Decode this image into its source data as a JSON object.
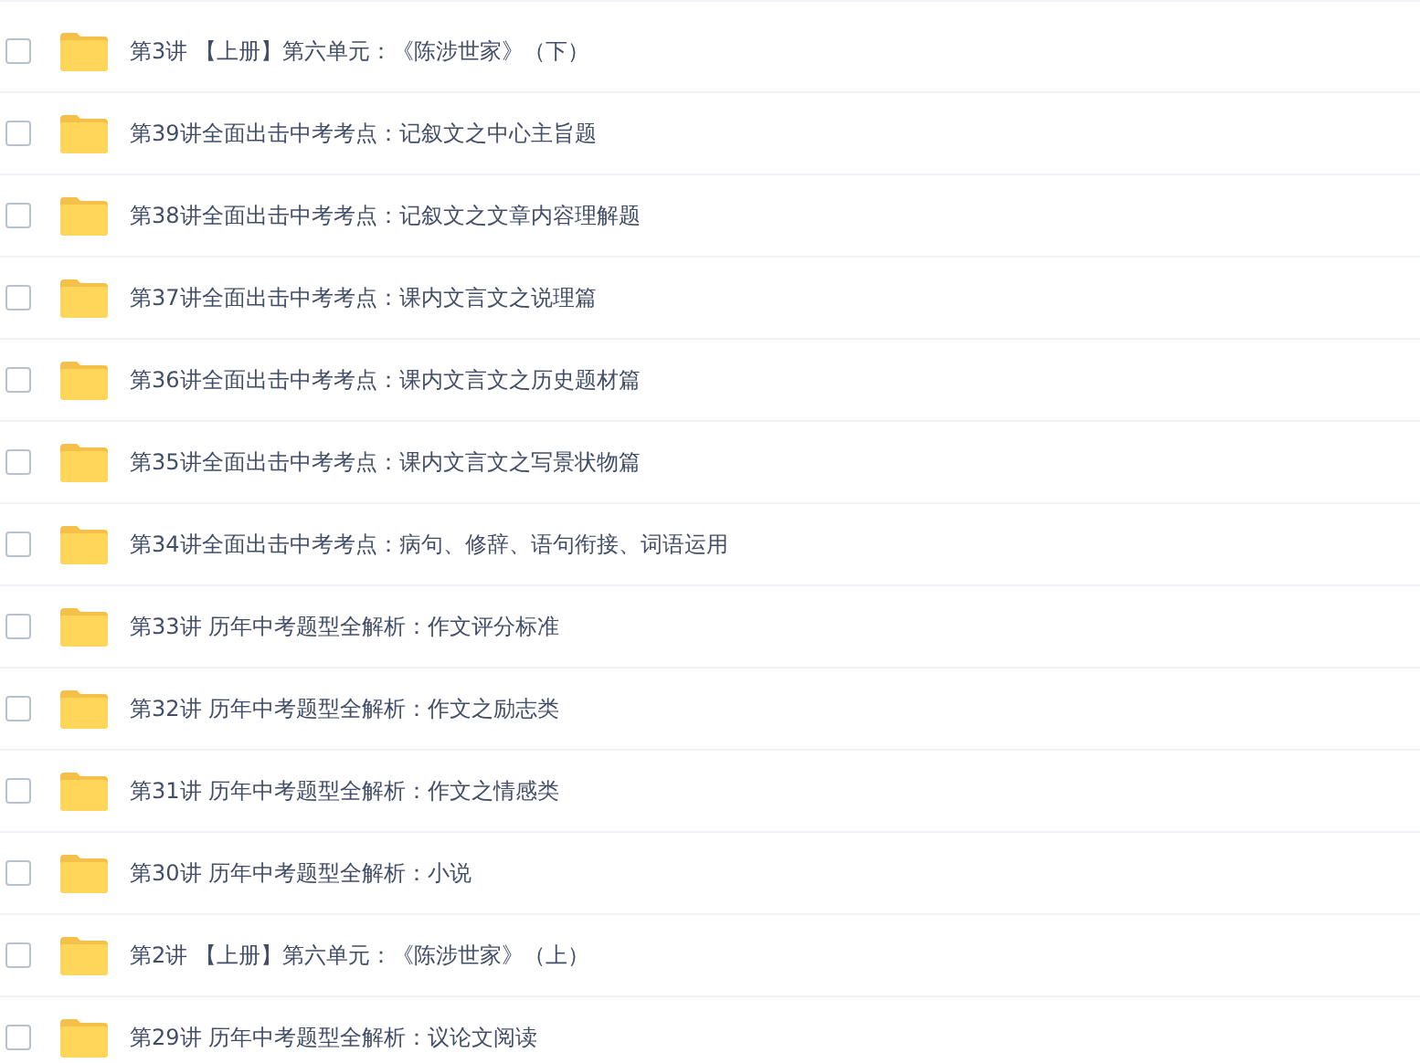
{
  "files": [
    {
      "name": "第3讲 【上册】第六单元：《陈涉世家》（下）",
      "checked": false
    },
    {
      "name": "第39讲全面出击中考考点：记叙文之中心主旨题",
      "checked": false
    },
    {
      "name": "第38讲全面出击中考考点：记叙文之文章内容理解题",
      "checked": false
    },
    {
      "name": "第37讲全面出击中考考点：课内文言文之说理篇",
      "checked": false
    },
    {
      "name": "第36讲全面出击中考考点：课内文言文之历史题材篇",
      "checked": false
    },
    {
      "name": "第35讲全面出击中考考点：课内文言文之写景状物篇",
      "checked": false
    },
    {
      "name": "第34讲全面出击中考考点：病句、修辞、语句衔接、词语运用",
      "checked": false
    },
    {
      "name": "第33讲 历年中考题型全解析：作文评分标准",
      "checked": false
    },
    {
      "name": "第32讲 历年中考题型全解析：作文之励志类",
      "checked": false
    },
    {
      "name": "第31讲 历年中考题型全解析：作文之情感类",
      "checked": false
    },
    {
      "name": "第30讲 历年中考题型全解析：小说",
      "checked": false
    },
    {
      "name": "第2讲 【上册】第六单元：《陈涉世家》（上）",
      "checked": false
    },
    {
      "name": "第29讲 历年中考题型全解析：议论文阅读",
      "checked": false
    }
  ]
}
